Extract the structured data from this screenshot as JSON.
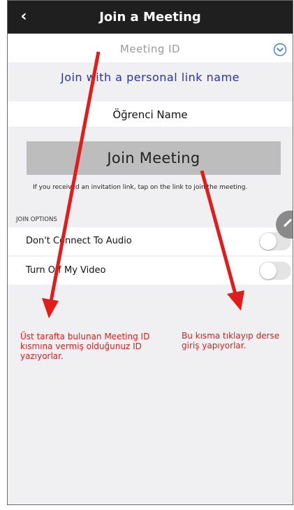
{
  "header": {
    "title": "Join a Meeting",
    "back_icon": "chevron-left-icon"
  },
  "meeting_id": {
    "placeholder": "Meeting ID",
    "dropdown_icon": "chevron-down-circle-icon"
  },
  "personal_link_label": "Join with a personal link name",
  "name_field": {
    "value": "Öğrenci Name"
  },
  "join_button_label": "Join Meeting",
  "help_text": "If you received an invitation link, tap on the link to join the meeting.",
  "join_options": {
    "label": "JOIN OPTIONS",
    "items": [
      {
        "label": "Don't Connect To Audio",
        "enabled": false
      },
      {
        "label": "Turn Off My Video",
        "enabled": false
      }
    ]
  },
  "annotations": {
    "left": "Üst tarafta bulunan Meeting ID kısmına vermiş olduğunuz ID yazıyorlar.",
    "right": "Bu kısma tıklayıp derse giriş yapıyorlar."
  },
  "colors": {
    "header_bg": "#1f1f1f",
    "link_blue": "#2a31b0",
    "annotation_red": "#e21b1b",
    "dropdown_blue": "#3b7ed8"
  }
}
